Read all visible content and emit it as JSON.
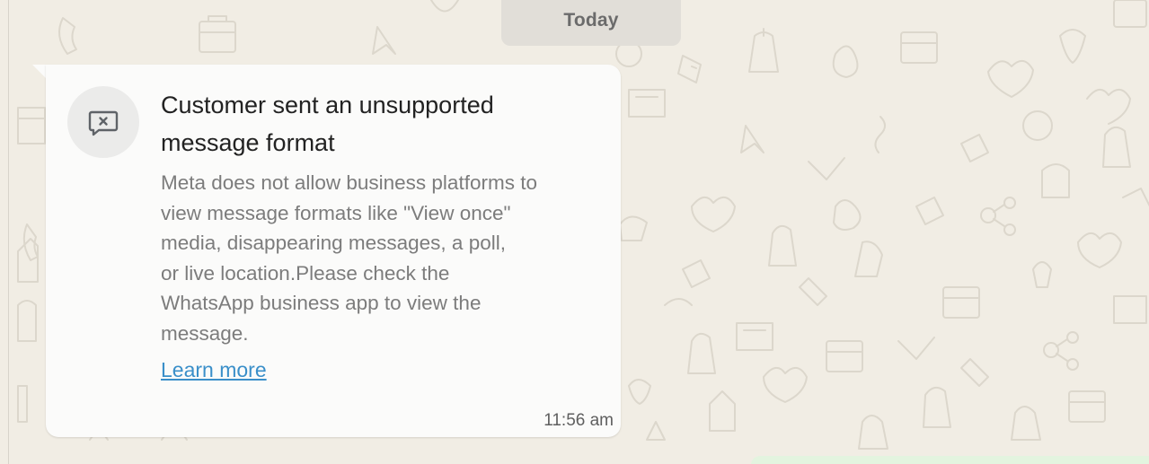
{
  "date_separator": {
    "label": "Today"
  },
  "message": {
    "title": "Customer sent an unsupported message format",
    "body": "Meta does not allow business platforms to\nview message formats like \"View once\"\nmedia, disappearing messages, a poll,\nor live location.Please check the\nWhatsApp business app to view the\nmessage.",
    "link_label": "Learn more",
    "time": "11:56 am",
    "icon": "message-x-icon"
  },
  "colors": {
    "chat_background": "#f1ede4",
    "bubble": "#fbfbfa",
    "title": "#222222",
    "body": "#7c7c7c",
    "link": "#3a8fc9",
    "date_pill": "#e1ded8"
  }
}
